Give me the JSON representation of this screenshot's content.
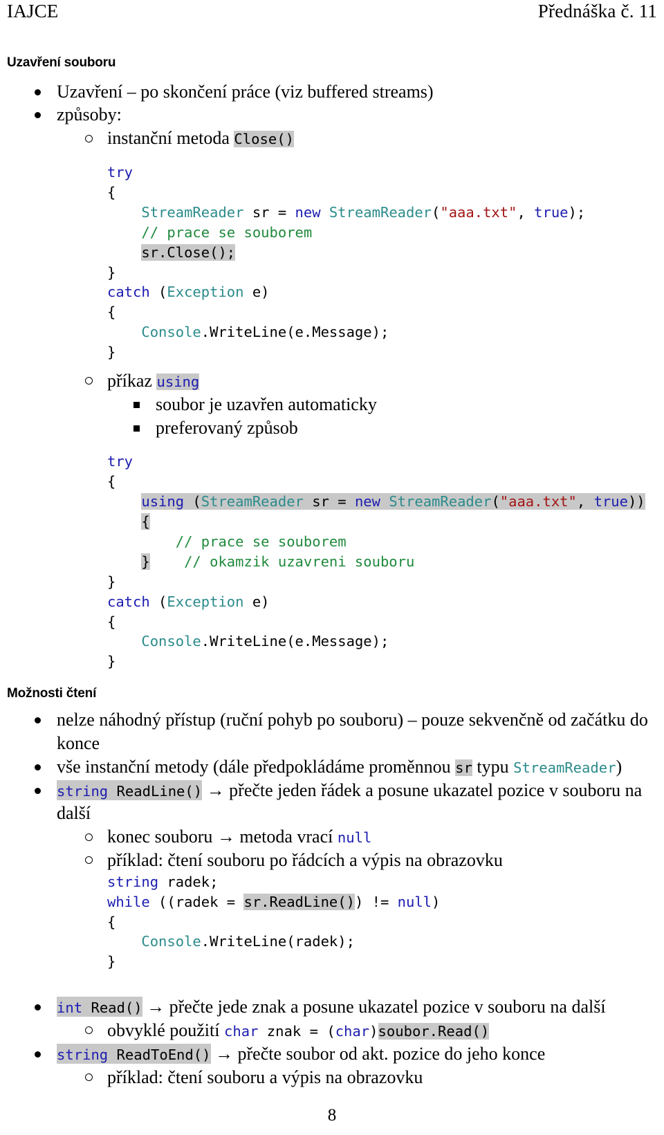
{
  "header": {
    "left": "IAJCE",
    "right": "Přednáška č. 11"
  },
  "headings": {
    "closing": "Uzavření souboru",
    "reading": "Možnosti čtení"
  },
  "colors": {
    "keyword": "#1C1CB0",
    "type": "#2B8B8B",
    "string": "#A31515",
    "comment": "#1F8A3C",
    "plain": "#000000",
    "highlight": "#C8C8C8"
  },
  "closing_section": {
    "bullets": {
      "b1_uzavreni": "Uzavření – po skončení práce (viz buffered streams)",
      "b1_zpusoby": "způsoby:",
      "b2_instancni_prefix": "instanční metoda ",
      "b2_instancni_code": "Close()",
      "b2_prikaz_prefix": "příkaz ",
      "b2_prikaz_code": "using",
      "b3_auto": "soubor je uzavřen automaticky",
      "b3_pref": "preferovaný způsob"
    },
    "code_close": {
      "l1_try": "try",
      "l2_brace": "{",
      "l3_type": "StreamReader",
      "l3_var": " sr = ",
      "l3_new": "new",
      "l3_type2": " StreamReader",
      "l3_paren": "(",
      "l3_str": "\"aaa.txt\"",
      "l3_comma": ", ",
      "l3_true": "true",
      "l3_end": ");",
      "l4_comment": "// prace se souborem",
      "l5_close": "sr.Close();",
      "l6_brace": "}",
      "l7_catch": "catch",
      "l7_sp": " (",
      "l7_type": "Exception",
      "l7_end": " e)",
      "l8_brace": "{",
      "l9_console": "Console",
      "l9_rest": ".WriteLine(e.Message);",
      "l10_brace": "}"
    },
    "code_using": {
      "l1_try": "try",
      "l2_brace": "{",
      "l3_using": "using",
      "l3_open": " (",
      "l3_type": "StreamReader",
      "l3_var": " sr = ",
      "l3_new": "new",
      "l3_type2": " StreamReader",
      "l3_paren": "(",
      "l3_str": "\"aaa.txt\"",
      "l3_comma": ", ",
      "l3_true": "true",
      "l3_end": "))",
      "l4_brace": "{",
      "l5_comment": "// prace se souborem",
      "l6_brace": "}",
      "l6_gap": "    ",
      "l6_comment": "// okamzik uzavreni souboru",
      "l7_brace": "}",
      "l8_catch": "catch",
      "l8_sp": " (",
      "l8_type": "Exception",
      "l8_end": " e)",
      "l9_brace": "{",
      "l10_console": "Console",
      "l10_rest": ".WriteLine(e.Message);",
      "l11_brace": "}"
    }
  },
  "reading_section": {
    "b1_nahodny": "nelze náhodný přístup (ruční pohyb po souboru) – pouze sekvenčně od začátku do konce",
    "b1_vse_pre": "vše instanční metody (dále předpokládáme proměnnou ",
    "b1_vse_sr": "sr",
    "b1_vse_mid": " typu ",
    "b1_vse_type": "StreamReader",
    "b1_vse_post": ")",
    "b1_readline_kw": "string",
    "b1_readline_name": " ReadLine()",
    "b1_readline_arrow": " → ",
    "b1_readline_text": "přečte jeden řádek a posune ukazatel pozice v souboru na další",
    "b2_konec_pre": "konec souboru → metoda vrací ",
    "b2_konec_null": "null",
    "b2_priklad_radky": "příklad: čtení souboru po řádcích a výpis na obrazovku",
    "code_readline": {
      "l1_kw": "string",
      "l1_rest": " radek;",
      "l2_kw": "while",
      "l2_mid": " ((radek = ",
      "l2_hl": "sr.ReadLine()",
      "l2_mid2": ") != ",
      "l2_null": "null",
      "l2_end": ")",
      "l3_brace": "{",
      "l4_console": "Console",
      "l4_rest": ".WriteLine(radek);",
      "l5_brace": "}"
    },
    "b1_read_kw": "int",
    "b1_read_name": " Read()",
    "b1_read_arrow": " → ",
    "b1_read_text": "přečte jede znak a posune ukazatel pozice v souboru na další",
    "b2_obvykle_pre": "obvyklé použití ",
    "b2_obvykle_char": "char",
    "b2_obvykle_mid": " znak = (",
    "b2_obvykle_char2": "char",
    "b2_obvykle_close": ")",
    "b2_obvykle_hl": "soubor.Read()",
    "b1_readtoend_kw": "string",
    "b1_readtoend_name": " ReadToEnd()",
    "b1_readtoend_arrow": " → ",
    "b1_readtoend_text": "přečte soubor od akt. pozice do jeho konce",
    "b2_priklad_vypis": "příklad: čtení souboru a výpis na obrazovku"
  },
  "footer": {
    "page_number": "8"
  }
}
